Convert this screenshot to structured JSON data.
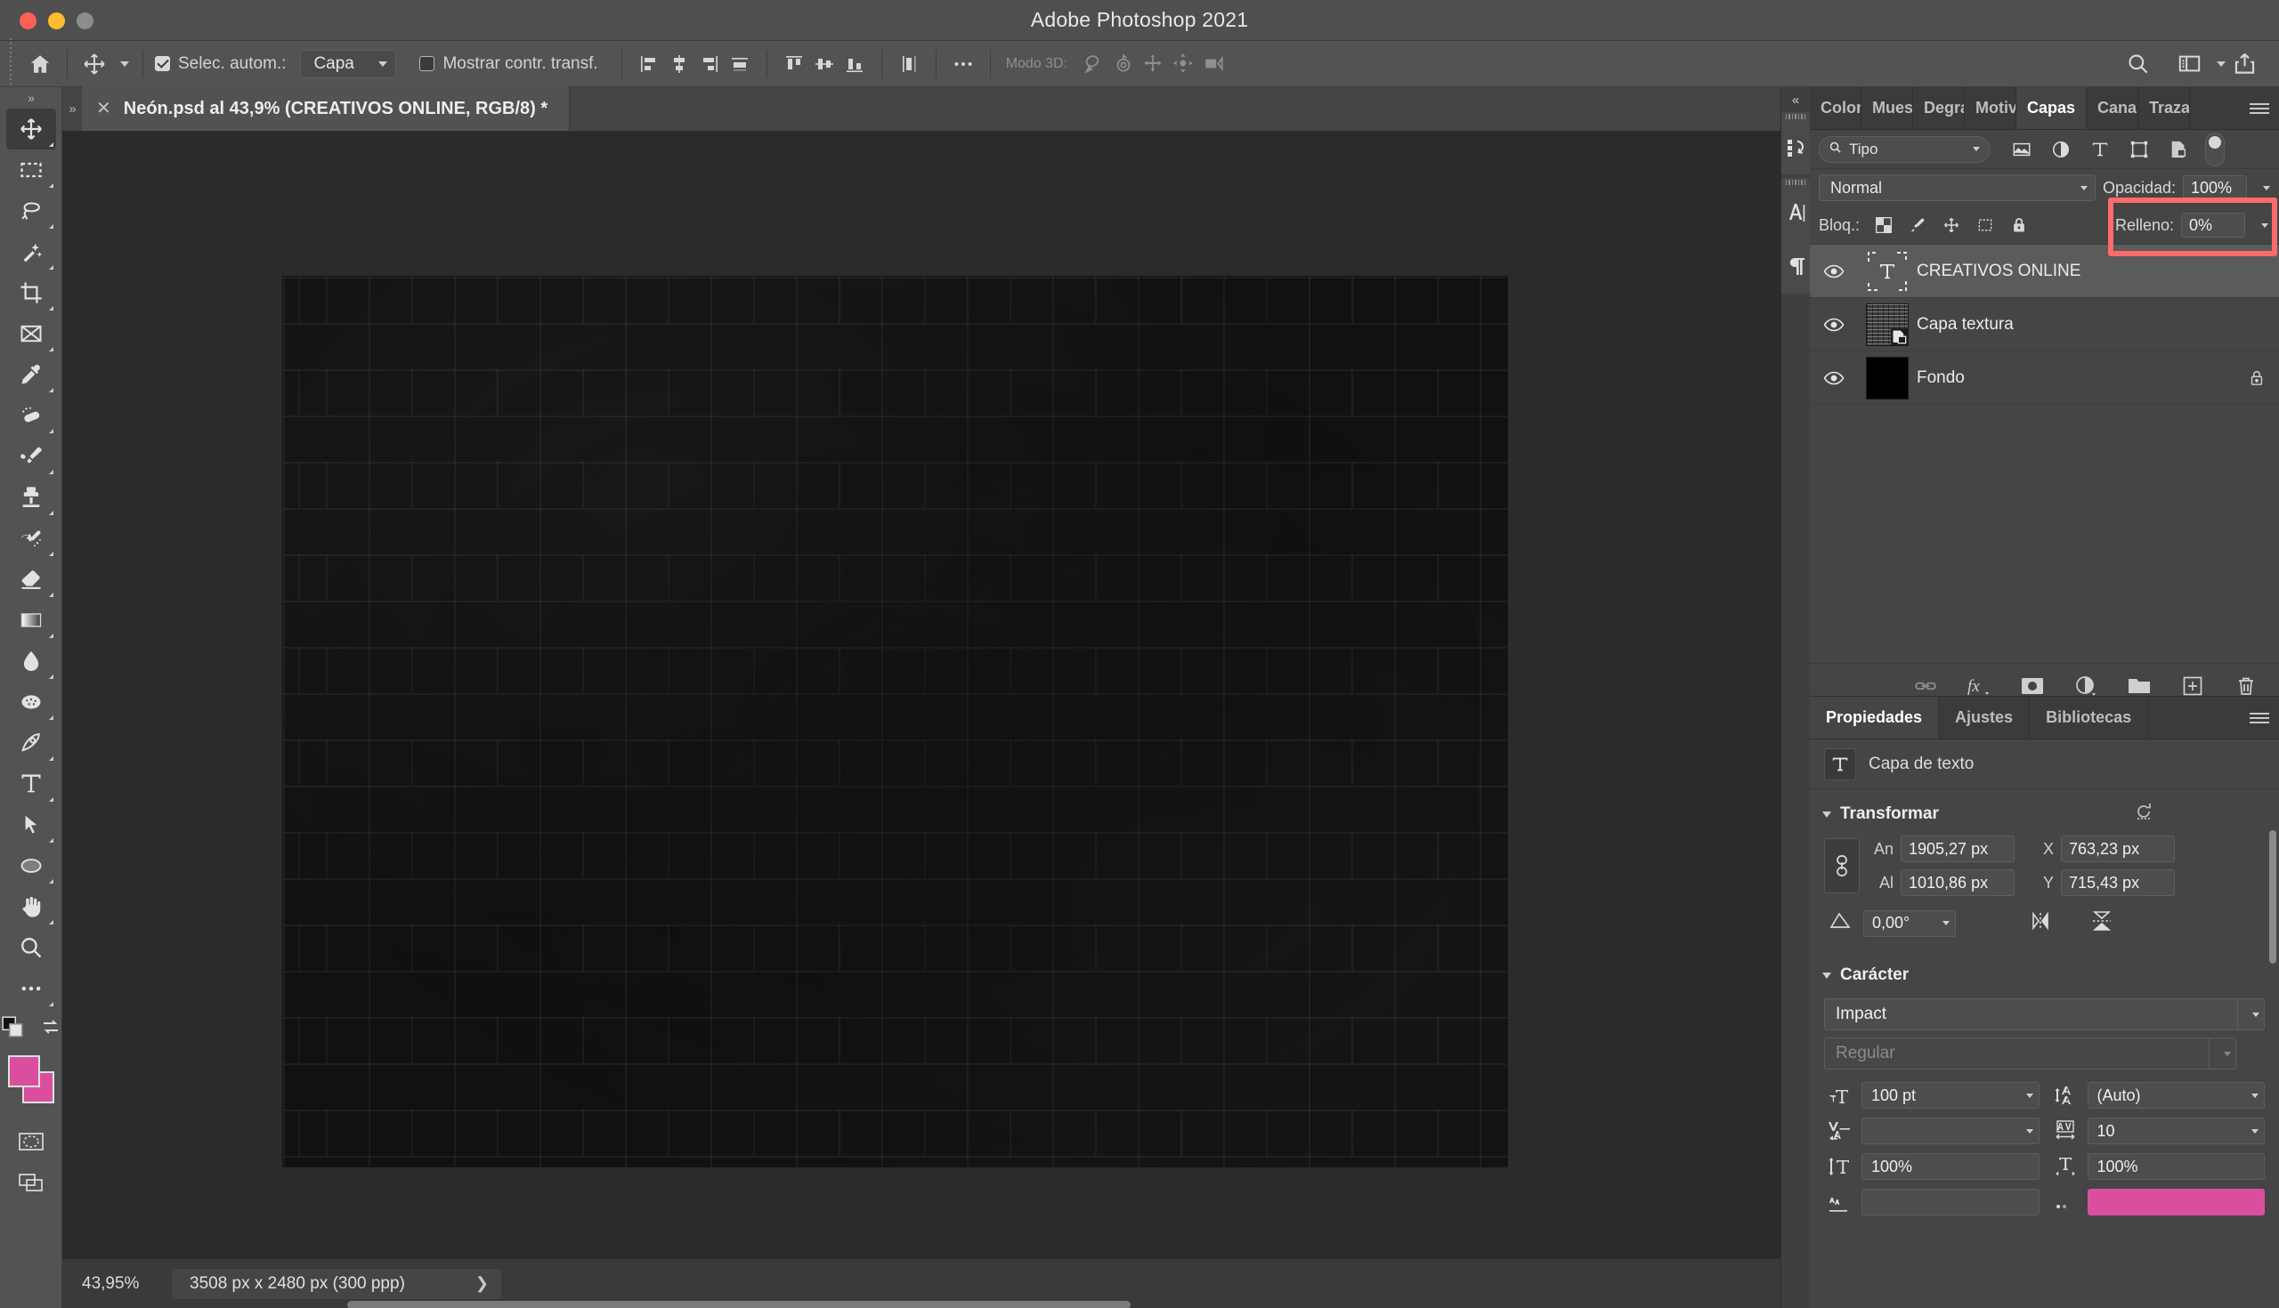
{
  "window": {
    "title": "Adobe Photoshop 2021",
    "traffic_lights": [
      "close-button",
      "minimize-button",
      "zoom-button"
    ]
  },
  "options_bar": {
    "home_icon": "home-icon",
    "tool_icon": "move-tool-icon",
    "auto_select": {
      "label": "Selec. autom.:",
      "checked": true,
      "value": "Capa"
    },
    "show_transform": {
      "label": "Mostrar contr. transf.",
      "checked": false
    },
    "align_icons": [
      "align-left-edges-icon",
      "align-horizontal-centers-icon",
      "align-right-edges-icon",
      "distribute-horizontally-icon",
      "align-top-edges-icon",
      "align-vertical-centers-icon",
      "align-bottom-edges-icon",
      "distribute-vertically-icon"
    ],
    "more_icon": "more-options-icon",
    "mode_3d_label": "Modo 3D:",
    "mode_3d_icons": [
      "orbit-3d-icon",
      "roll-3d-icon",
      "pan-3d-icon",
      "slide-3d-icon",
      "camera-3d-icon"
    ],
    "right_icons": [
      "search-icon",
      "workspace-icon",
      "chevron-down-icon",
      "share-icon"
    ]
  },
  "toolbar": {
    "tools": [
      {
        "name": "move-tool",
        "selected": true
      },
      {
        "name": "rectangular-marquee-tool",
        "selected": false
      },
      {
        "name": "lasso-tool",
        "selected": false
      },
      {
        "name": "magic-wand-tool",
        "selected": false
      },
      {
        "name": "crop-tool",
        "selected": false
      },
      {
        "name": "frame-tool",
        "selected": false
      },
      {
        "name": "eyedropper-tool",
        "selected": false
      },
      {
        "name": "healing-brush-tool",
        "selected": false
      },
      {
        "name": "brush-tool",
        "selected": false
      },
      {
        "name": "clone-stamp-tool",
        "selected": false
      },
      {
        "name": "history-brush-tool",
        "selected": false
      },
      {
        "name": "eraser-tool",
        "selected": false
      },
      {
        "name": "gradient-tool",
        "selected": false
      },
      {
        "name": "blur-tool",
        "selected": false
      },
      {
        "name": "dodge-tool",
        "selected": false
      },
      {
        "name": "pen-tool",
        "selected": false
      },
      {
        "name": "horizontal-type-tool",
        "selected": false
      },
      {
        "name": "path-selection-tool",
        "selected": false
      },
      {
        "name": "ellipse-tool",
        "selected": false
      },
      {
        "name": "hand-tool",
        "selected": false
      },
      {
        "name": "zoom-tool",
        "selected": false
      },
      {
        "name": "edit-toolbar-tool",
        "selected": false
      }
    ],
    "foreground_color": "#d94f9e",
    "background_color": "#d94f9e",
    "quick_mask_icon": "quick-mask-icon",
    "screen_mode_icon": "screen-mode-icon"
  },
  "document": {
    "tab_label": "Neón.psd al 43,9% (CREATIVOS  ONLINE, RGB/8) *",
    "close_icon": "close-icon"
  },
  "status_bar": {
    "zoom": "43,95%",
    "size": "3508 px x 2480 px (300 ppp)",
    "expand_icon": "chevron-right-icon"
  },
  "mini_dock": {
    "collapse_icon": "collapse-panels-icon",
    "buttons": [
      "history-icon",
      "character-icon",
      "paragraph-icon"
    ]
  },
  "layers_panel": {
    "tabs": [
      {
        "label": "Color",
        "active": false
      },
      {
        "label": "Muestras",
        "active": false
      },
      {
        "label": "Degradados",
        "active": false
      },
      {
        "label": "Motivos",
        "active": false
      },
      {
        "label": "Capas",
        "active": true
      },
      {
        "label": "Canales",
        "active": false
      },
      {
        "label": "Trazados",
        "active": false
      }
    ],
    "menu_icon": "panel-menu-icon",
    "filter": {
      "search_icon": "search-icon",
      "value": "Tipo",
      "caret_icon": "chevron-down-icon",
      "type_icons": [
        "filter-pixel-icon",
        "filter-adjustment-icon",
        "filter-type-icon",
        "filter-shape-icon",
        "filter-smart-object-icon"
      ],
      "toggle_icon": "filter-toggle-switch"
    },
    "blend_mode": "Normal",
    "opacity_label": "Opacidad:",
    "opacity_value": "100%",
    "lock_label": "Bloq.:",
    "lock_icons": [
      "lock-transparent-pixels-icon",
      "lock-image-pixels-icon",
      "lock-position-icon",
      "lock-artboard-nesting-icon",
      "lock-all-icon"
    ],
    "fill_label": "Relleno:",
    "fill_value": "0%",
    "highlight_color": "#ff6b6b",
    "layers": [
      {
        "name": "CREATIVOS  ONLINE",
        "visible": true,
        "selected": true,
        "thumb": "type-layer-thumb",
        "locked": false
      },
      {
        "name": "Capa textura",
        "visible": true,
        "selected": false,
        "thumb": "smart-object-thumb",
        "locked": false
      },
      {
        "name": "Fondo",
        "visible": true,
        "selected": false,
        "thumb": "solid-black-thumb",
        "locked": true
      }
    ],
    "footer_icons": [
      "link-layers-icon",
      "layer-styles-fx-icon",
      "add-layer-mask-icon",
      "new-adjustment-layer-icon",
      "new-group-icon",
      "new-layer-icon",
      "delete-layer-icon"
    ]
  },
  "properties_panel": {
    "tabs": [
      {
        "label": "Propiedades",
        "active": true
      },
      {
        "label": "Ajustes",
        "active": false
      },
      {
        "label": "Bibliotecas",
        "active": false
      }
    ],
    "menu_icon": "panel-menu-icon",
    "layer_type_icon": "type-layer-icon",
    "layer_type_label": "Capa de texto",
    "transform": {
      "title": "Transformar",
      "reset_icon": "reset-icon",
      "link_icon": "link-dimensions-icon",
      "width_label": "An",
      "width_value": "1905,27 px",
      "height_label": "Al",
      "height_value": "1010,86 px",
      "x_label": "X",
      "x_value": "763,23 px",
      "y_label": "Y",
      "y_value": "715,43 px",
      "angle_icon": "angle-icon",
      "angle_value": "0,00°",
      "flip_horizontal_icon": "flip-horizontal-icon",
      "flip_vertical_icon": "flip-vertical-icon"
    },
    "character": {
      "title": "Carácter",
      "font_family": "Impact",
      "font_style": "Regular",
      "size_icon": "font-size-icon",
      "size_value": "100 pt",
      "leading_icon": "leading-icon",
      "leading_value": "(Auto)",
      "kerning_icon": "kerning-icon",
      "kerning_value": "",
      "tracking_icon": "tracking-icon",
      "tracking_value": "10",
      "vscale_icon": "vertical-scale-icon",
      "vscale_value": "100%",
      "hscale_icon": "horizontal-scale-icon",
      "hscale_value": "100%",
      "baseline_icon": "baseline-shift-icon",
      "color_icon": "text-color-icon",
      "text_color": "#d94f9e"
    }
  }
}
